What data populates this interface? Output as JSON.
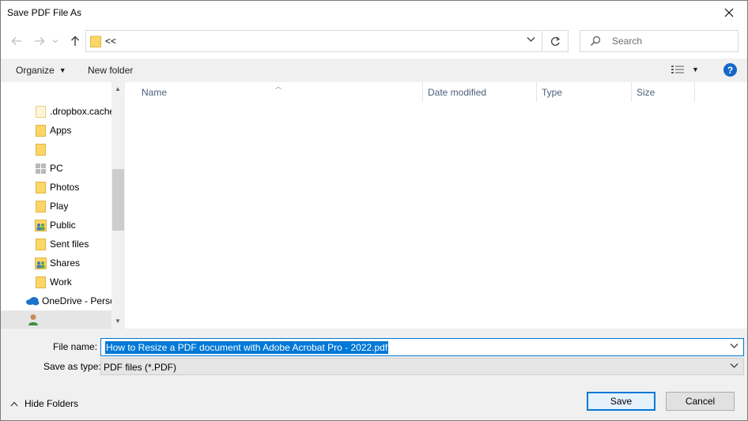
{
  "window": {
    "title": "Save PDF File As"
  },
  "address": {
    "path": "<<"
  },
  "search": {
    "placeholder": "Search"
  },
  "toolbar": {
    "organize_label": "Organize",
    "new_folder_label": "New folder",
    "help_label": "?"
  },
  "nav": {
    "items": [
      {
        "label": ".dropbox.cache",
        "icon": "folder-icon"
      },
      {
        "label": "Apps",
        "icon": "folder-icon"
      },
      {
        "label": "",
        "icon": "folder-icon"
      },
      {
        "label": "PC",
        "icon": "pc-icon"
      },
      {
        "label": "Photos",
        "icon": "folder-icon"
      },
      {
        "label": "Play",
        "icon": "folder-icon"
      },
      {
        "label": "Public",
        "icon": "shared-folder-icon"
      },
      {
        "label": "Sent files",
        "icon": "folder-icon"
      },
      {
        "label": "Shares",
        "icon": "shared-folder-icon"
      },
      {
        "label": "Work",
        "icon": "folder-icon"
      },
      {
        "label": "OneDrive - Perso",
        "icon": "onedrive-icon"
      },
      {
        "label": "",
        "icon": "user-icon"
      }
    ]
  },
  "filelist": {
    "columns": [
      "Name",
      "Date modified",
      "Type",
      "Size"
    ]
  },
  "form": {
    "filename_label": "File name:",
    "filename_value": "How to Resize a PDF document with Adobe Acrobat Pro - 2022.pdf",
    "savetype_label": "Save as type:",
    "savetype_value": "PDF files (*.PDF)"
  },
  "footer": {
    "hide_folders_label": "Hide Folders",
    "save_label": "Save",
    "cancel_label": "Cancel"
  }
}
